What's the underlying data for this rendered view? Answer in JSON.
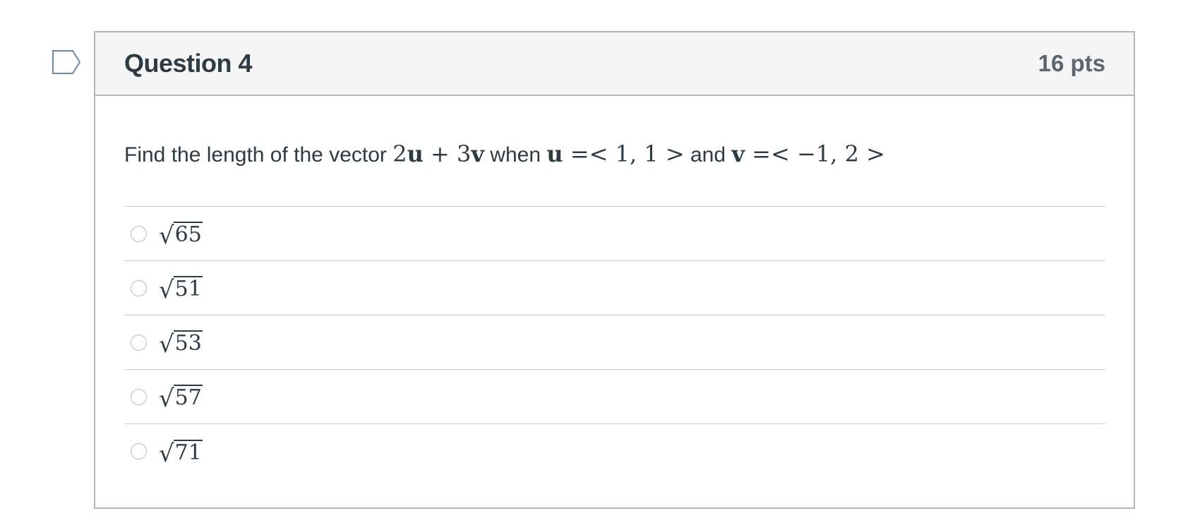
{
  "question": {
    "title": "Question 4",
    "points": "16 pts",
    "flag_icon": "bookmark-flag-icon",
    "prompt": {
      "text_before": "Find the length of the vector ",
      "expr_coef1": "2",
      "expr_var1": "u",
      "expr_plus": " + ",
      "expr_coef2": "3",
      "expr_var2": "v",
      "text_when": " when ",
      "u_var": "u",
      "u_value": " =< 1, 1 >",
      "text_and": " and ",
      "v_var": "v",
      "v_value": " =< −1, 2 >"
    },
    "answers": [
      {
        "sqrt_symbol": "√",
        "radicand": "65",
        "selected": false
      },
      {
        "sqrt_symbol": "√",
        "radicand": "51",
        "selected": false
      },
      {
        "sqrt_symbol": "√",
        "radicand": "53",
        "selected": false
      },
      {
        "sqrt_symbol": "√",
        "radicand": "57",
        "selected": false
      },
      {
        "sqrt_symbol": "√",
        "radicand": "71",
        "selected": false
      }
    ]
  },
  "colors": {
    "border": "#b5b5b5",
    "header_bg": "#f5f5f5",
    "text": "#2d3b45",
    "flag_stroke": "#6b8aa6"
  }
}
